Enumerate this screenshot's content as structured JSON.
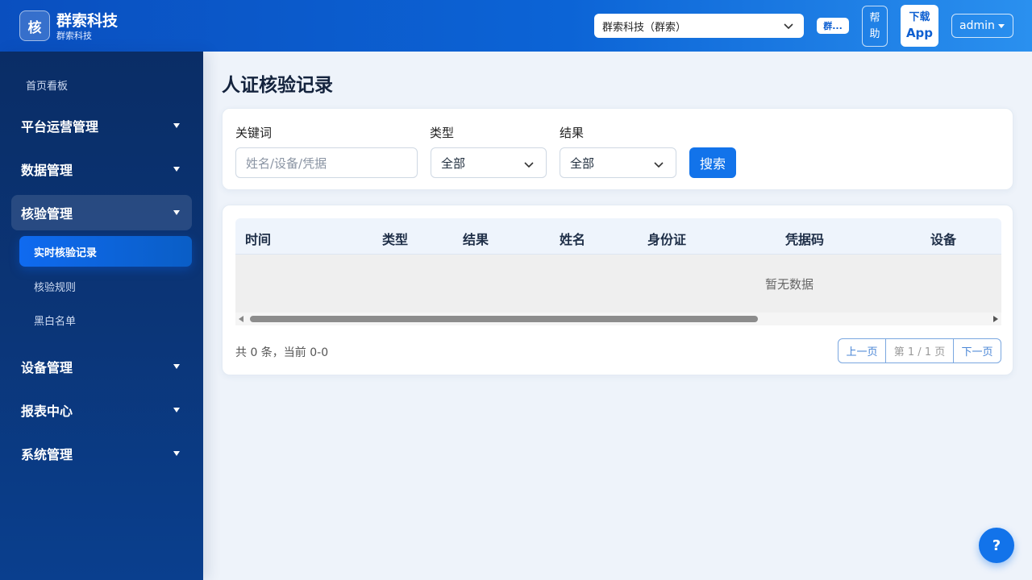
{
  "header": {
    "logo_char": "核",
    "brand_title": "群索科技",
    "brand_subtitle": "群索科技",
    "tenant_select_value": "群索科技（群索）",
    "tenant_chip": "群...",
    "help_label": "帮助",
    "app_line1": "下载",
    "app_line2": "App",
    "user_name": "admin"
  },
  "sidebar": {
    "home": "首页看板",
    "groups": [
      {
        "label": "平台运营管理"
      },
      {
        "label": "数据管理"
      },
      {
        "label": "核验管理"
      },
      {
        "label": "设备管理"
      },
      {
        "label": "报表中心"
      },
      {
        "label": "系统管理"
      }
    ],
    "sub_items": [
      {
        "label": "实时核验记录"
      },
      {
        "label": "核验规则"
      },
      {
        "label": "黑白名单"
      }
    ]
  },
  "page": {
    "title": "人证核验记录"
  },
  "filters": {
    "keyword_label": "关键词",
    "keyword_placeholder": "姓名/设备/凭据",
    "type_label": "类型",
    "type_value": "全部",
    "result_label": "结果",
    "result_value": "全部",
    "search_label": "搜索"
  },
  "table": {
    "columns": [
      "时间",
      "类型",
      "结果",
      "姓名",
      "身份证",
      "凭据码",
      "设备"
    ],
    "empty_text": "暂无数据",
    "summary": "共 0 条，当前 0-0"
  },
  "pager": {
    "prev": "上一页",
    "info": "第 1 / 1 页",
    "next": "下一页"
  },
  "help_fab": "?",
  "colors": {
    "primary": "#1273ea",
    "header_start": "#0a4fbf",
    "header_end": "#2a90ef",
    "sidebar": "#0a2d66"
  }
}
